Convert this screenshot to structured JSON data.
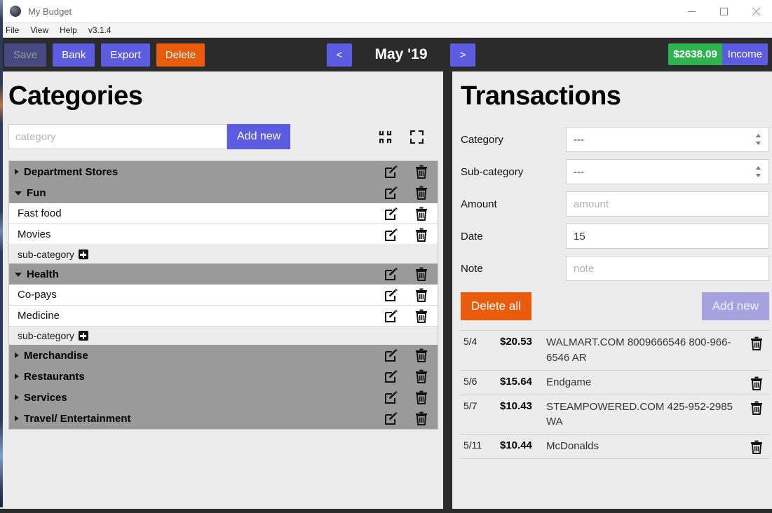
{
  "window": {
    "title": "My Budget",
    "logo_icon": "app-logo-icon",
    "controls": {
      "minimize": "minimize-icon",
      "maximize": "maximize-icon",
      "close": "close-icon"
    }
  },
  "menubar": {
    "items": [
      "File",
      "View",
      "Help"
    ],
    "version": "v3.1.4"
  },
  "toolbar": {
    "save_label": "Save",
    "bank_label": "Bank",
    "export_label": "Export",
    "delete_label": "Delete",
    "prev_label": "<",
    "next_label": ">",
    "month_label": "May '19",
    "income_amount": "$2638.09",
    "income_label": "Income",
    "colors": {
      "bar_bg": "#2b2b2b",
      "purple": "#5c5ce0",
      "purple_disabled": "#474a82",
      "orange": "#ea5b0c",
      "green": "#2eb44f"
    }
  },
  "categories_panel": {
    "title": "Categories",
    "input_placeholder": "category",
    "input_value": "",
    "add_button_label": "Add new",
    "collapse_all_icon": "collapse-all-icon",
    "expand_all_icon": "expand-all-icon",
    "subcategory_add_label": "sub-category",
    "subcategory_add_icon": "plus-square-icon",
    "edit_icon": "edit-pencil-icon",
    "delete_icon": "trash-icon",
    "groups": [
      {
        "name": "Department Stores",
        "expanded": false,
        "subcategories": []
      },
      {
        "name": "Fun",
        "expanded": true,
        "subcategories": [
          "Fast food",
          "Movies"
        ]
      },
      {
        "name": "Health",
        "expanded": true,
        "subcategories": [
          "Co-pays",
          "Medicine"
        ]
      },
      {
        "name": "Merchandise",
        "expanded": false,
        "subcategories": []
      },
      {
        "name": "Restaurants",
        "expanded": false,
        "subcategories": []
      },
      {
        "name": "Services",
        "expanded": false,
        "subcategories": []
      },
      {
        "name": "Travel/ Entertainment",
        "expanded": false,
        "subcategories": []
      }
    ]
  },
  "transactions_panel": {
    "title": "Transactions",
    "form": {
      "category_label": "Category",
      "category_value": "---",
      "subcategory_label": "Sub-category",
      "subcategory_value": "---",
      "amount_label": "Amount",
      "amount_placeholder": "amount",
      "amount_value": "",
      "date_label": "Date",
      "date_value": "15",
      "note_label": "Note",
      "note_placeholder": "note",
      "note_value": ""
    },
    "delete_all_label": "Delete all",
    "add_new_label": "Add new",
    "delete_icon": "trash-icon",
    "rows": [
      {
        "date": "5/4",
        "amount": "$20.53",
        "note": "WALMART.COM 8009666546 800-966-6546 AR"
      },
      {
        "date": "5/6",
        "amount": "$15.64",
        "note": "Endgame"
      },
      {
        "date": "5/7",
        "amount": "$10.43",
        "note": "STEAMPOWERED.COM 425-952-2985 WA"
      },
      {
        "date": "5/11",
        "amount": "$10.44",
        "note": "McDonalds"
      }
    ]
  }
}
